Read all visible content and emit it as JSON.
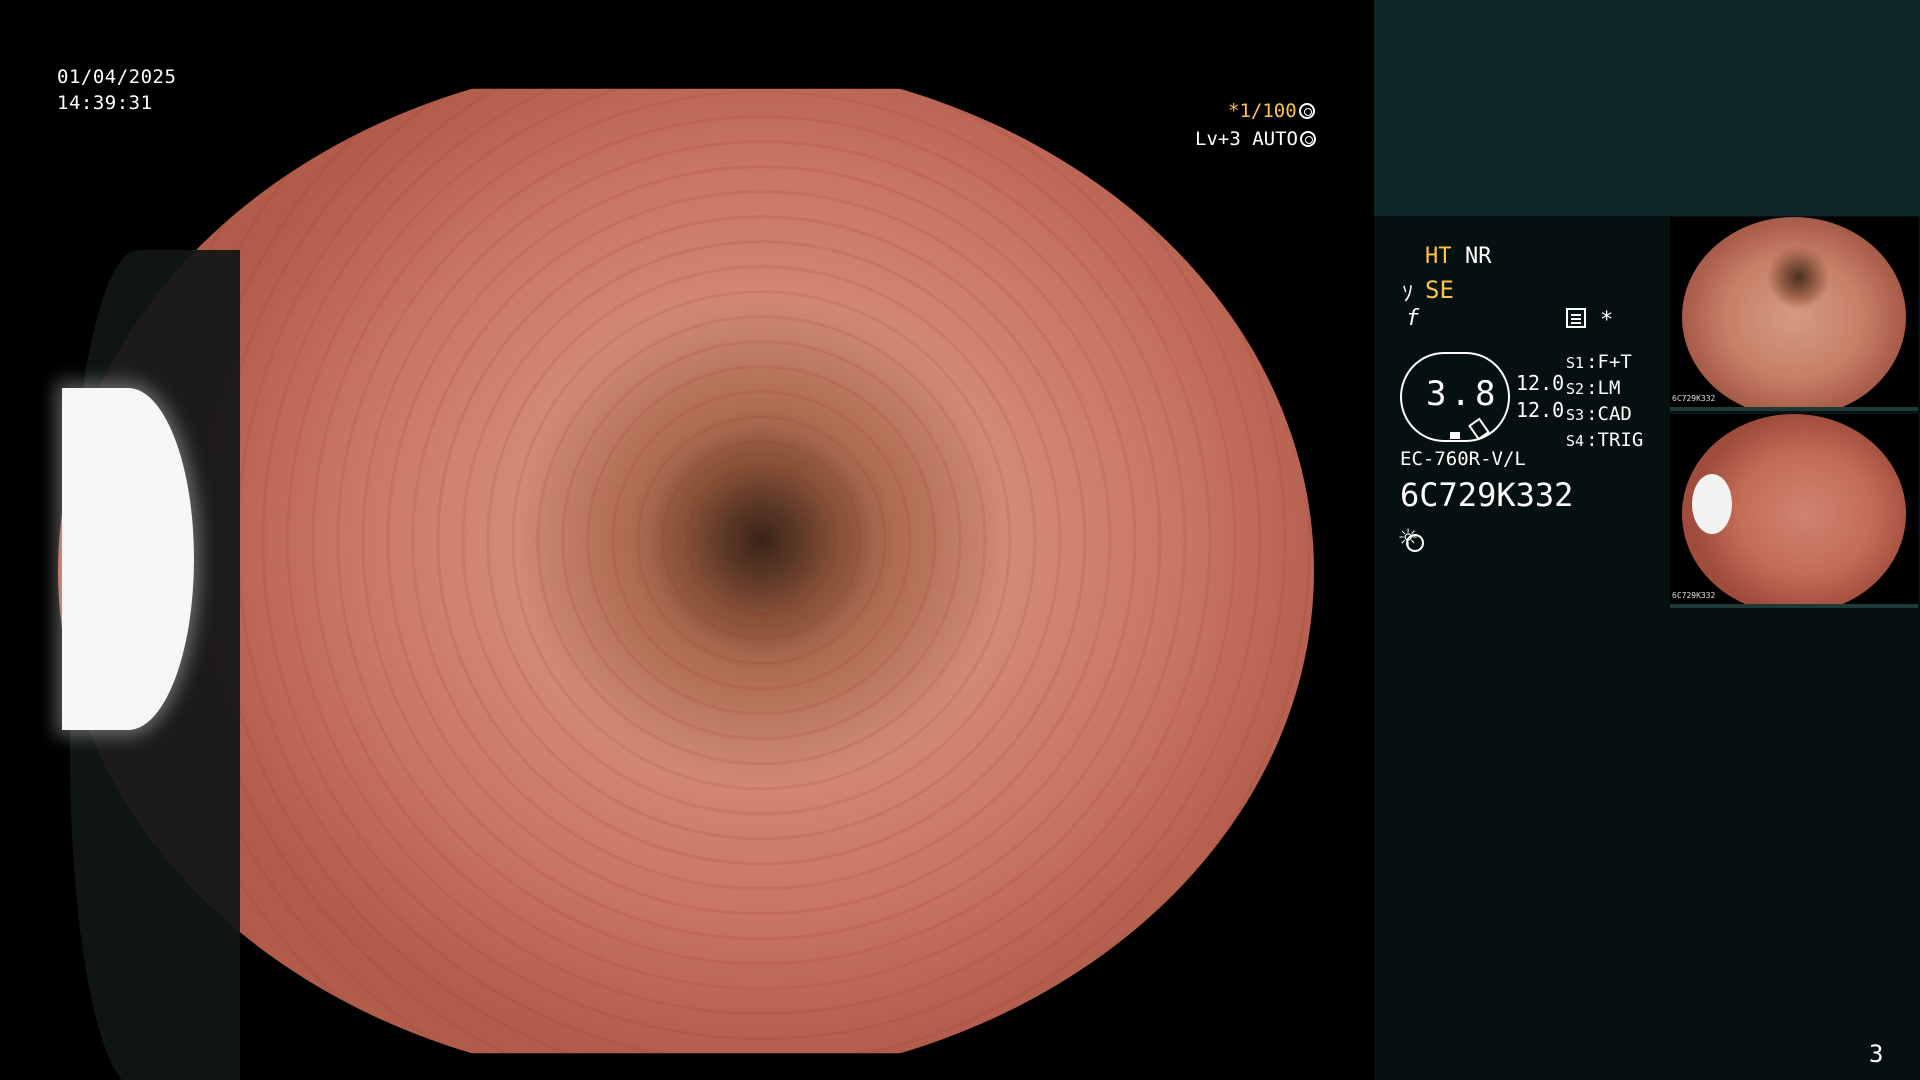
{
  "overlay": {
    "date": "01/04/2025",
    "time": "14:39:31",
    "shutter": "*1/100",
    "level": "Lv+3 AUTO"
  },
  "side": {
    "ht": "HT",
    "nr": "NR",
    "se": "SE",
    "star": "*",
    "gauge_value": "3.8",
    "value_top": "12.0",
    "value_bottom": "12.0",
    "s_items": [
      {
        "label": "S1",
        "value": "F+T"
      },
      {
        "label": "S2",
        "value": "LM"
      },
      {
        "label": "S3",
        "value": "CAD"
      },
      {
        "label": "S4",
        "value": "TRIG"
      }
    ],
    "model": "EC-760R-V/L",
    "serial": "6C729K332",
    "thumb1_caption": "6C729K332",
    "thumb2_caption": "6C729K332"
  },
  "page_number": "3",
  "colors": {
    "accent_yellow": "#ffc24a",
    "panel_bg": "#041110",
    "panel_top": "#0e2828"
  }
}
